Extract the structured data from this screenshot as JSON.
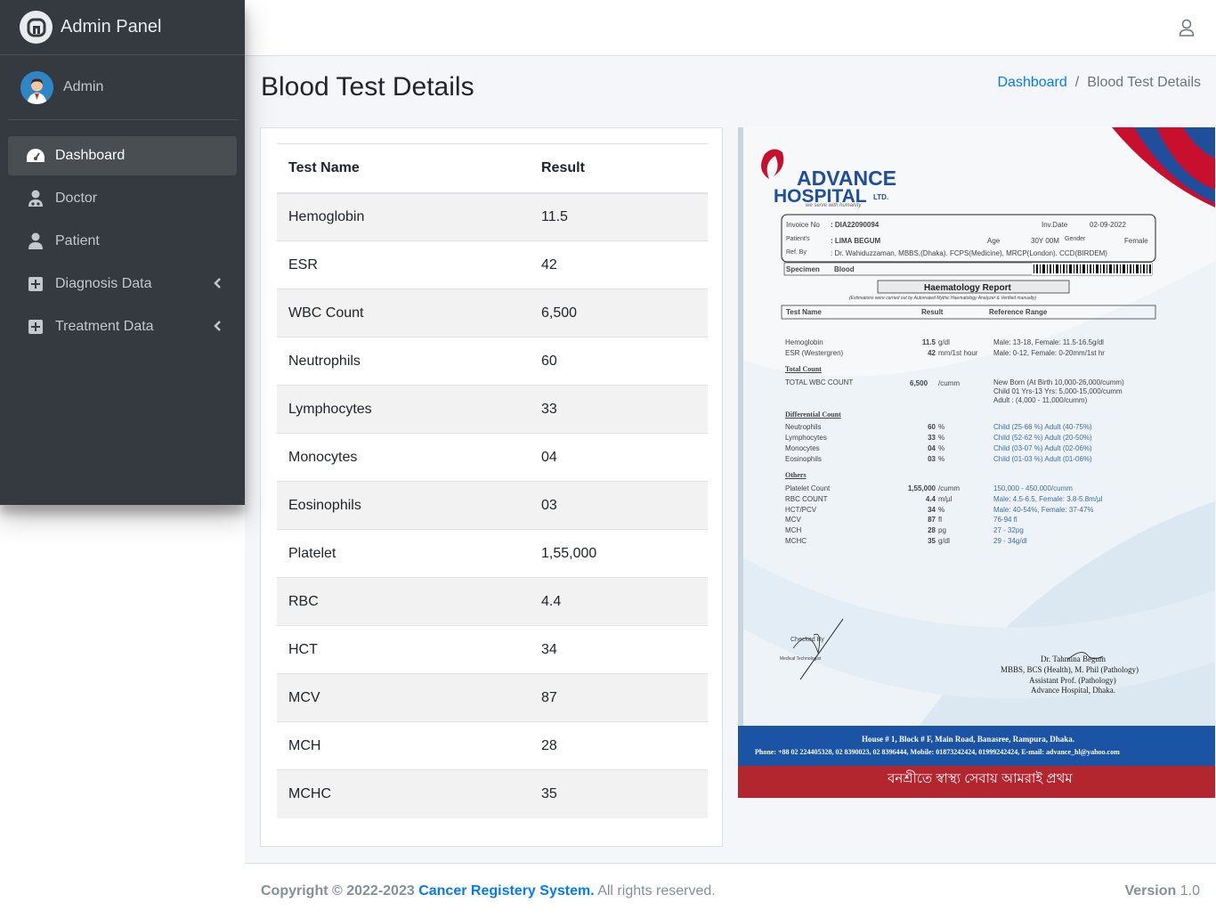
{
  "brand": {
    "title": "Admin Panel"
  },
  "user": {
    "name": "Admin"
  },
  "sidebar": {
    "items": [
      {
        "label": "Dashboard",
        "icon": "tachometer-icon",
        "active": true
      },
      {
        "label": "Doctor",
        "icon": "user-md-icon"
      },
      {
        "label": "Patient",
        "icon": "user-icon"
      },
      {
        "label": "Diagnosis Data",
        "icon": "plus-square-icon",
        "has_submenu": true
      },
      {
        "label": "Treatment Data",
        "icon": "plus-square-icon",
        "has_submenu": true
      }
    ]
  },
  "header": {
    "page_title": "Blood Test Details",
    "breadcrumb": {
      "home": "Dashboard",
      "separator": "/",
      "current": "Blood Test Details"
    }
  },
  "table": {
    "headers": [
      "Test Name",
      "Result"
    ],
    "rows": [
      [
        "Hemoglobin",
        "11.5"
      ],
      [
        "ESR",
        "42"
      ],
      [
        "WBC Count",
        "6,500"
      ],
      [
        "Neutrophils",
        "60"
      ],
      [
        "Lymphocytes",
        "33"
      ],
      [
        "Monocytes",
        "04"
      ],
      [
        "Eosinophils",
        "03"
      ],
      [
        "Platelet",
        "1,55,000"
      ],
      [
        "RBC",
        "4.4"
      ],
      [
        "HCT",
        "34"
      ],
      [
        "MCV",
        "87"
      ],
      [
        "MCH",
        "28"
      ],
      [
        "MCHC",
        "35"
      ]
    ]
  },
  "report": {
    "hospital_line1": "ADVANCE",
    "hospital_line2": "HOSPITAL",
    "hospital_suffix": "LTD.",
    "tagline": "we serve with humanity",
    "invoice_label": "Invoice No",
    "invoice_no": ": DIA22090094",
    "inv_date_label": "Inv.Date",
    "inv_date": "02-09-2022",
    "patient_label": "Patient's",
    "patient_name": ": LIMA BEGUM",
    "age_label": "Age",
    "age": "30Y 00M",
    "gender_label": "Gender",
    "gender": "Female",
    "ref_label": "Ref. By",
    "ref_by": ": Dr. Wahiduzzaman, MBBS,(Dhaka). FCPS(Medicine), MRCP(London). CCD(BIRDEM)",
    "specimen_label": "Specimen",
    "specimen": "Blood",
    "report_title": "Haematology Report",
    "report_note": "(Estimations were carried out by Automated Mythic Haematology Analyzer & Verified manually)",
    "col_headers": [
      "Test Name",
      "Result",
      "Reference Range"
    ],
    "lines": [
      {
        "name": "Hemoglobin",
        "result": "11.5",
        "unit": "g/dl",
        "range": "Male: 13-18, Female: 11.5-16.5g/dl"
      },
      {
        "name": "ESR (Westergren)",
        "result": "42",
        "unit": "mm/1st hour",
        "range": "Male: 0-12, Female: 0-20mm/1st hr"
      }
    ],
    "section_total": "Total Count",
    "total_wbc": {
      "name": "TOTAL WBC COUNT",
      "result": "6,500",
      "unit": "/cumm",
      "range1": "New Born (At Birth 10,000-26,000/cumm)",
      "range2": "Child 01 Yrs-13 Yrs: 5,000-15,000/cumm",
      "range3": "Adult : (4,000 - 11,000/cumm)"
    },
    "section_diff": "Differential Count",
    "diff": [
      {
        "name": "Neutrophils",
        "result": "60",
        "unit": "%",
        "range": "Child (25-66 %) Adult (40-75%)"
      },
      {
        "name": "Lymphocytes",
        "result": "33",
        "unit": "%",
        "range": "Child (52-62 %) Adult (20-50%)"
      },
      {
        "name": "Monocytes",
        "result": "04",
        "unit": "%",
        "range": "Child (03-07 %) Adult (02-06%)"
      },
      {
        "name": "Eosinophils",
        "result": "03",
        "unit": "%",
        "range": "Child (01-03 %) Adult (01-06%)"
      }
    ],
    "section_others": "Others",
    "others": [
      {
        "name": "Platelet Count",
        "result": "1,55,000",
        "unit": "/cumm",
        "range": "150,000 - 450,000/cumm"
      },
      {
        "name": "RBC COUNT",
        "result": "4.4",
        "unit": "m/µl",
        "range": "Male: 4.5-6.5, Female: 3.8-5.8m/µl"
      },
      {
        "name": "HCT/PCV",
        "result": "34",
        "unit": "%",
        "range": "Male: 40-54%, Female: 37-47%"
      },
      {
        "name": "MCV",
        "result": "87",
        "unit": "fl",
        "range": "76-94 fl"
      },
      {
        "name": "MCH",
        "result": "28",
        "unit": "pg",
        "range": "27 - 32pg"
      },
      {
        "name": "MCHC",
        "result": "35",
        "unit": "g/dl",
        "range": "29 - 34g/dl"
      }
    ],
    "checked_by": "Checked By",
    "tech": "Medical Technologist",
    "doctor_name": "Dr. Tahmina Begum",
    "doctor_deg": "MBBS, BCS (Health), M. Phil (Pathology)",
    "doctor_title": "Assistant Prof. (Pathology)",
    "doctor_org": "Advance Hospital, Dhaka.",
    "address": "House # 1, Block # F, Main Road, Banasree, Rampura, Dhaka.",
    "phone": "Phone: +88 02 224405328, 02 8390023, 02 8396444, Mobile: 01873242424, 01999242424, E-mail: advance_hl@yahoo.com",
    "slogan": "বনশ্রীতে স্বাস্থ্য সেবায় আমরাই প্রথম"
  },
  "footer": {
    "copyright_prefix": "Copyright © 2022-2023",
    "system_name": "Cancer Registery System.",
    "rights": "All rights reserved.",
    "version_label": "Version",
    "version": "1.0"
  },
  "colors": {
    "sidebar": "#343a40",
    "link": "#007bff",
    "content_bg": "#f4f6f9"
  }
}
